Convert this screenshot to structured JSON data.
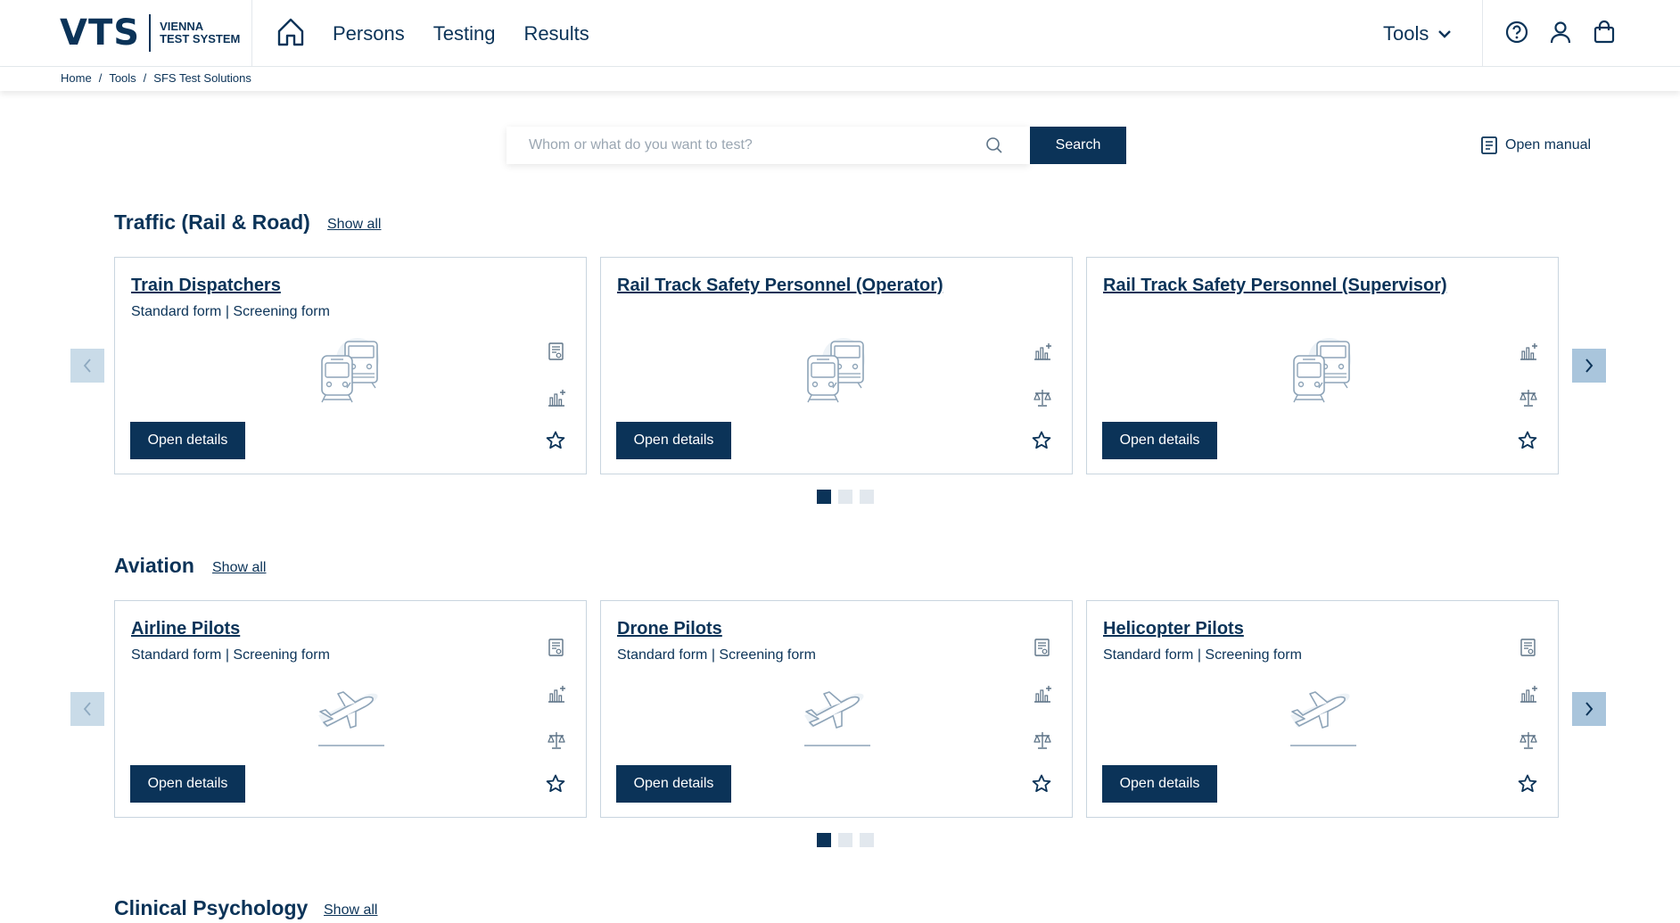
{
  "header": {
    "logo": {
      "brand": "VTS",
      "sub_line1": "VIENNA",
      "sub_line2": "TEST SYSTEM"
    },
    "nav": [
      "Persons",
      "Testing",
      "Results"
    ],
    "tools_label": "Tools",
    "icons": [
      "home-icon",
      "help-icon",
      "user-icon",
      "cart-icon",
      "chevron-down-icon"
    ]
  },
  "breadcrumb": [
    "Home",
    "Tools",
    "SFS Test Solutions"
  ],
  "breadcrumb_sep": "/",
  "search": {
    "placeholder": "Whom or what do you want to test?",
    "button": "Search"
  },
  "manual_label": "Open manual",
  "sections": [
    {
      "title": "Traffic (Rail & Road)",
      "show_all": "Show all",
      "cards": [
        {
          "title": "Train Dispatchers",
          "subtitle": "Standard form | Screening form",
          "button": "Open details",
          "illustration": "train-icon",
          "icons": [
            "document-icon",
            "chart-icon"
          ]
        },
        {
          "title": "Rail Track Safety Personnel (Operator)",
          "subtitle": "",
          "button": "Open details",
          "illustration": "train-icon",
          "icons": [
            "chart-icon",
            "scale-icon"
          ]
        },
        {
          "title": "Rail Track Safety Personnel (Supervisor)",
          "subtitle": "",
          "button": "Open details",
          "illustration": "train-icon",
          "icons": [
            "chart-icon",
            "scale-icon"
          ]
        }
      ],
      "pages": 3,
      "active_page": 1
    },
    {
      "title": "Aviation",
      "show_all": "Show all",
      "cards": [
        {
          "title": "Airline Pilots",
          "subtitle": "Standard form | Screening form",
          "button": "Open details",
          "illustration": "airplane-icon",
          "icons": [
            "document-icon",
            "chart-icon",
            "scale-icon"
          ]
        },
        {
          "title": "Drone Pilots",
          "subtitle": "Standard form | Screening form",
          "button": "Open details",
          "illustration": "airplane-icon",
          "icons": [
            "document-icon",
            "chart-icon",
            "scale-icon"
          ]
        },
        {
          "title": "Helicopter Pilots",
          "subtitle": "Standard form | Screening form",
          "button": "Open details",
          "illustration": "airplane-icon",
          "icons": [
            "document-icon",
            "chart-icon",
            "scale-icon"
          ]
        }
      ],
      "pages": 3,
      "active_page": 1
    },
    {
      "title": "Clinical Psychology",
      "show_all": "Show all"
    }
  ],
  "colors": {
    "navy": "#0b3358",
    "card_border": "#c9d5df",
    "arrow_left": "#c9dbe8",
    "arrow_right": "#a9c5dc"
  }
}
